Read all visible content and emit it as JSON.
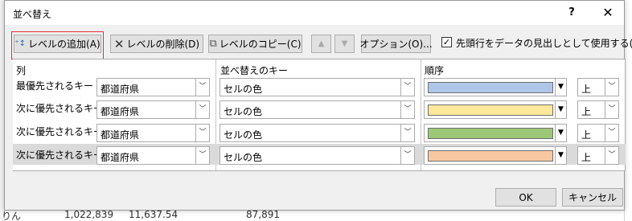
{
  "title": "並べ替え",
  "titlebar": {
    "help": "?",
    "close": "✕"
  },
  "toolbar": {
    "add_level": "レベルの追加(A)",
    "delete_level": "レベルの削除(D)",
    "copy_level": "レベルのコピー(C)",
    "move_up": "▲",
    "move_down": "▼",
    "options": "オプション(O)...",
    "header_checkbox_label": "先頭行をデータの見出しとして使用する(H)",
    "header_checkbox_checked": true
  },
  "columns": {
    "column": "列",
    "sort_on": "並べ替えのキー",
    "order": "順序"
  },
  "rows": [
    {
      "label": "最優先されるキー",
      "column": "都道府県",
      "sort_on": "セルの色",
      "color": "#aec6e8",
      "position": "上"
    },
    {
      "label": "次に優先されるキー",
      "column": "都道府県",
      "sort_on": "セルの色",
      "color": "#fde89b",
      "position": "上"
    },
    {
      "label": "次に優先されるキー",
      "column": "都道府県",
      "sort_on": "セルの色",
      "color": "#9cc777",
      "position": "上"
    },
    {
      "label": "次に優先されるキー",
      "column": "都道府県",
      "sort_on": "セルの色",
      "color": "#f8c8a3",
      "position": "上"
    }
  ],
  "footer": {
    "ok": "OK",
    "cancel": "キャンセル"
  },
  "background_sheet": {
    "left_text": "りん",
    "values": [
      "1,022,839",
      "11,637.54",
      "87,891"
    ]
  }
}
